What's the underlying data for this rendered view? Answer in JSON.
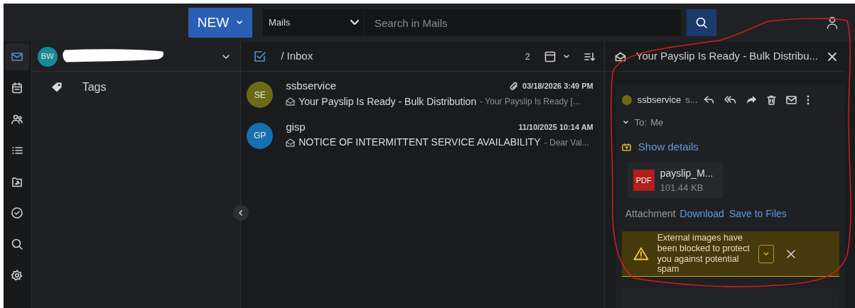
{
  "top_bar": {
    "new_button": "NEW",
    "scope_select": "Mails",
    "search": {
      "placeholder": "Search in Mails"
    }
  },
  "rail": [
    {
      "kind": "mail",
      "selected": true
    },
    {
      "kind": "calendar",
      "selected": false
    },
    {
      "kind": "contacts",
      "selected": false
    },
    {
      "kind": "list",
      "selected": false
    },
    {
      "kind": "files",
      "selected": false
    },
    {
      "kind": "tasks",
      "selected": false
    },
    {
      "kind": "search",
      "selected": false
    },
    {
      "kind": "settings",
      "selected": false
    }
  ],
  "account": {
    "initials": "BW"
  },
  "folders": [
    {
      "label": "Tags"
    }
  ],
  "mail_list": {
    "path": "/ Inbox",
    "count": "2",
    "messages": [
      {
        "initials": "SE",
        "color": "#6b6b17",
        "sender": "ssbservice",
        "date": "03/18/2026 3:49 PM",
        "attachment": true,
        "subject": "Your Payslip Is Ready - Bulk Distribution",
        "preview": "- Your Payslip Is Ready [..."
      },
      {
        "initials": "GP",
        "color": "#1570b0",
        "sender": "gisp",
        "date": "11/10/2025 10:14 AM",
        "attachment": false,
        "subject": "NOTICE OF INTERMITTENT SERVICE AVAILABILITY",
        "preview": "- Dear Val..."
      }
    ]
  },
  "reader": {
    "title": "Your Payslip Is Ready - Bulk Distribu...",
    "sender": "ssbservice",
    "sender_address": "s...",
    "to_label": "To:",
    "to": "Me",
    "show_details": "Show details",
    "attachment": {
      "badge": "PDF",
      "name": "payslip_M...",
      "size": "101.44 KB"
    },
    "attachment_label": "Attachment",
    "actions": [
      "Download",
      "Save to Files"
    ],
    "alert": "External images have been blocked to protect you against potential spam"
  }
}
